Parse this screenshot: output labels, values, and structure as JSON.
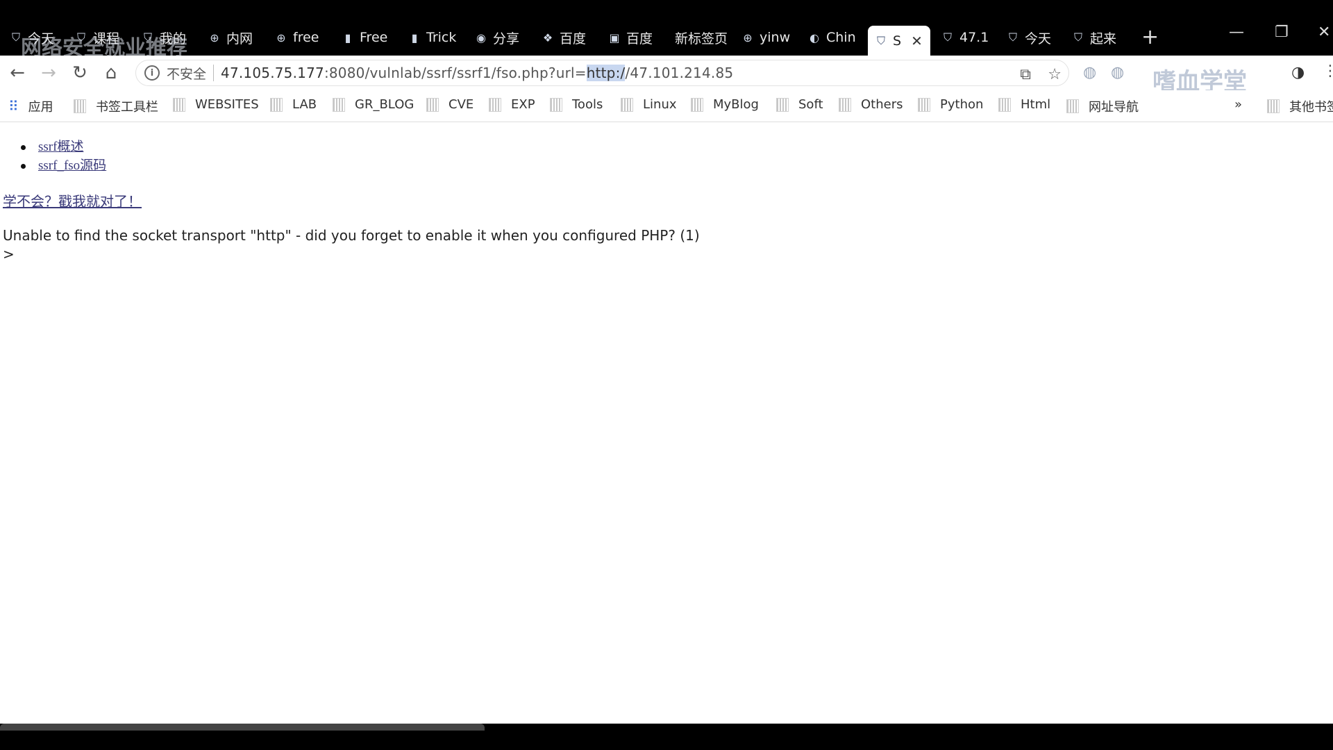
{
  "tabs": [
    {
      "label": "今天",
      "icon": "shield-icon"
    },
    {
      "label": "课程",
      "icon": "shield-icon"
    },
    {
      "label": "我的",
      "icon": "shield-icon"
    },
    {
      "label": "内网",
      "icon": "globe-icon"
    },
    {
      "label": "free",
      "icon": "globe-icon"
    },
    {
      "label": "Free",
      "icon": "doc-icon"
    },
    {
      "label": "Trick",
      "icon": "doc-icon"
    },
    {
      "label": "分享",
      "icon": "weibo-icon"
    },
    {
      "label": "百度",
      "icon": "paw-icon"
    },
    {
      "label": "百度",
      "icon": "doc-icon"
    },
    {
      "label": "新标签页",
      "icon": ""
    },
    {
      "label": "yinw",
      "icon": "globe-icon"
    },
    {
      "label": "Chin",
      "icon": "cd-icon"
    },
    {
      "label": "S",
      "icon": "shield-icon",
      "active": true
    },
    {
      "label": "47.1",
      "icon": "shield-icon"
    },
    {
      "label": "今天",
      "icon": "shield-icon"
    },
    {
      "label": "起来",
      "icon": "shield-icon"
    }
  ],
  "watermark": {
    "top_left": "网络安全就业推荐",
    "top_right": "嗜血学堂"
  },
  "toolbar": {
    "security_label": "不安全",
    "url_host": "47.105.75.177",
    "url_path": ":8080/vulnlab/ssrf/ssrf1/fso.php?url=",
    "url_selected": "http:/",
    "url_rest": "/47.101.214.85"
  },
  "bookmarks": {
    "apps_label": "应用",
    "items": [
      "书签工具栏",
      "WEBSITES",
      "LAB",
      "GR_BLOG",
      "CVE",
      "EXP",
      "Tools",
      "Linux",
      "MyBlog",
      "Soft",
      "Others",
      "Python",
      "Html",
      "网址导航"
    ],
    "overflow": "»",
    "other": "其他书签"
  },
  "page": {
    "links": [
      "ssrf概述",
      "ssrf_fso源码"
    ],
    "help_link": "学不会？戳我就对了！",
    "error": "Unable to find the socket transport \"http\" - did you forget to enable it when you configured PHP? (1)",
    "prompt": ">"
  }
}
